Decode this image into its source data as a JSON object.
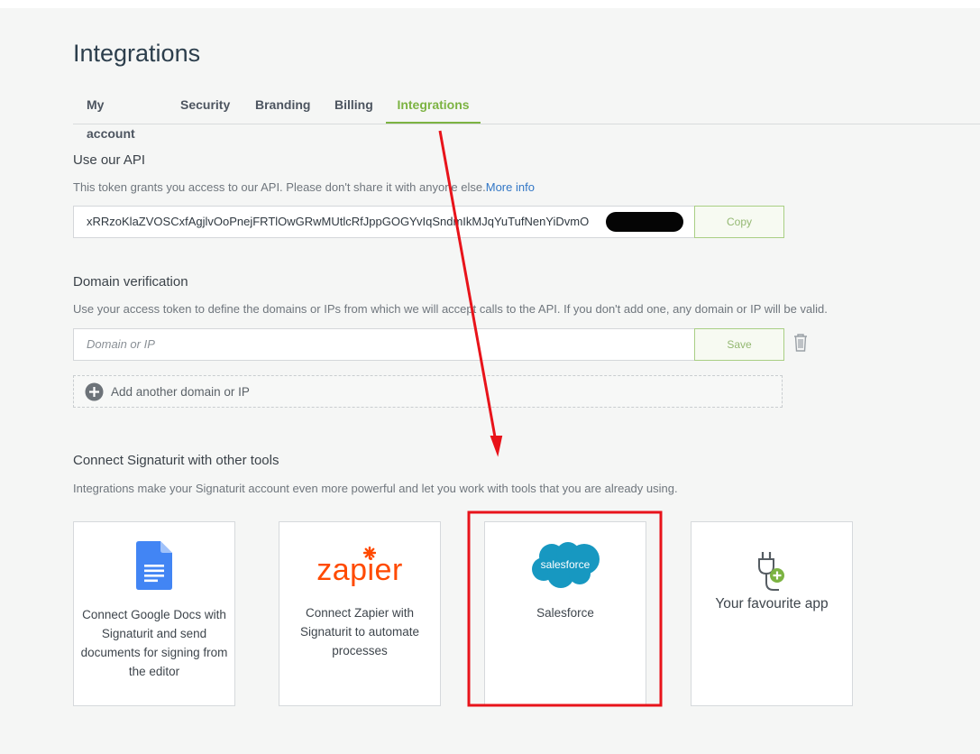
{
  "page": {
    "title": "Integrations"
  },
  "tabs": [
    {
      "label": "My account"
    },
    {
      "label": "Security"
    },
    {
      "label": "Branding"
    },
    {
      "label": "Billing"
    },
    {
      "label": "Integrations",
      "active": true
    }
  ],
  "api": {
    "title": "Use our API",
    "description": "This token grants you access to our API. Please don't share it with anyone else.",
    "more_info": "More info",
    "token": "xRRzoKlaZVOSCxfAgjlvOoPnejFRTlOwGRwMUtlcRfJppGOGYvIqSndmIkMJqYuTufNenYiDvmO",
    "copy_label": "Copy"
  },
  "domain": {
    "title": "Domain verification",
    "description": "Use your access token to define the domains or IPs from which we will accept calls to the API. If you don't add one, any domain or IP will be valid.",
    "placeholder": "Domain or IP",
    "save_label": "Save",
    "add_label": "Add another domain or IP"
  },
  "tools": {
    "title": "Connect Signaturit with other tools",
    "description": "Integrations make your Signaturit account even more powerful and let you work with tools that you are already using.",
    "cards": [
      {
        "text": "Connect Google Docs with Signaturit and send documents for signing from the editor",
        "icon": "google-docs-icon"
      },
      {
        "logo": "zapier",
        "text": "Connect Zapier with Signaturit to automate processes",
        "icon": "zapier-logo"
      },
      {
        "logo": "salesforce",
        "text": "Salesforce",
        "icon": "salesforce-logo"
      },
      {
        "text": "Your favourite app",
        "icon": "plug-add-icon"
      }
    ]
  },
  "colors": {
    "accent": "#7cb342",
    "link": "#3277c6",
    "annotation": "#e8131a",
    "salesforce": "#1798c1",
    "zapier": "#ff4a00",
    "google_docs": "#4285f4"
  }
}
